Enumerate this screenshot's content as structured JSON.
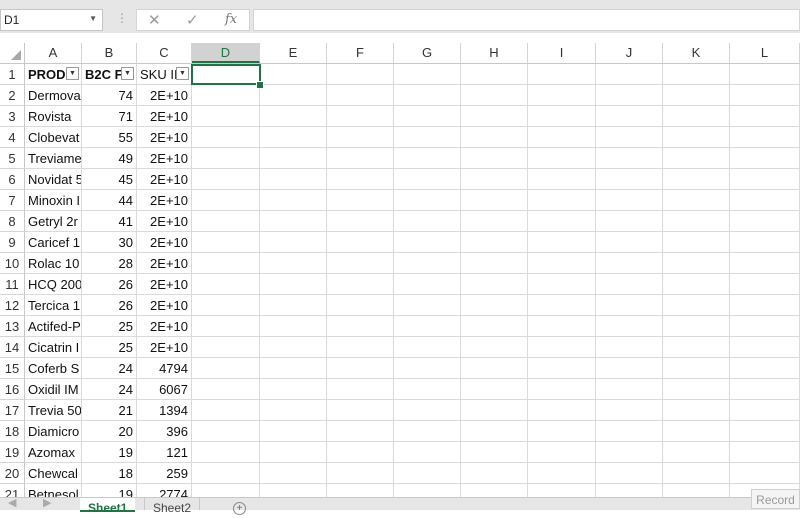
{
  "formula_bar": {
    "name_box": "D1",
    "cancel_icon": "✕",
    "enter_icon": "✓",
    "function_icon": "fx",
    "formula": ""
  },
  "columns": [
    "A",
    "B",
    "C",
    "D",
    "E",
    "F",
    "G",
    "H",
    "I",
    "J",
    "K",
    "L"
  ],
  "selected_column": "D",
  "header_row": {
    "row": "1",
    "a": "PRODU",
    "b": "B2C F",
    "c": "SKU II"
  },
  "rows": [
    {
      "row": "2",
      "a": "Dermova",
      "b": "74",
      "c": "2E+10"
    },
    {
      "row": "3",
      "a": "Rovista",
      "b": "71",
      "c": "2E+10"
    },
    {
      "row": "4",
      "a": "Clobevat",
      "b": "55",
      "c": "2E+10"
    },
    {
      "row": "5",
      "a": "Treviame",
      "b": "49",
      "c": "2E+10"
    },
    {
      "row": "6",
      "a": "Novidat 5",
      "b": "45",
      "c": "2E+10"
    },
    {
      "row": "7",
      "a": "Minoxin I",
      "b": "44",
      "c": "2E+10"
    },
    {
      "row": "8",
      "a": "Getryl 2r",
      "b": "41",
      "c": "2E+10"
    },
    {
      "row": "9",
      "a": "Caricef 1",
      "b": "30",
      "c": "2E+10"
    },
    {
      "row": "10",
      "a": "Rolac 10",
      "b": "28",
      "c": "2E+10"
    },
    {
      "row": "11",
      "a": "HCQ 200",
      "b": "26",
      "c": "2E+10"
    },
    {
      "row": "12",
      "a": "Tercica 1",
      "b": "26",
      "c": "2E+10"
    },
    {
      "row": "13",
      "a": "Actifed-P",
      "b": "25",
      "c": "2E+10"
    },
    {
      "row": "14",
      "a": "Cicatrin I",
      "b": "25",
      "c": "2E+10"
    },
    {
      "row": "15",
      "a": "Coferb S",
      "b": "24",
      "c": "4794"
    },
    {
      "row": "16",
      "a": "Oxidil IM",
      "b": "24",
      "c": "6067"
    },
    {
      "row": "17",
      "a": "Trevia 50",
      "b": "21",
      "c": "1394"
    },
    {
      "row": "18",
      "a": "Diamicro",
      "b": "20",
      "c": "396"
    },
    {
      "row": "19",
      "a": "Azomax",
      "b": "19",
      "c": "121"
    },
    {
      "row": "20",
      "a": "Chewcal",
      "b": "18",
      "c": "259"
    },
    {
      "row": "21",
      "a": "Betnesol",
      "b": "19",
      "c": "2774"
    }
  ],
  "sheets": [
    {
      "label": "Sheet1",
      "active": true
    },
    {
      "label": "Sheet2",
      "active": false
    }
  ],
  "add_sheet_icon": "+",
  "status": {
    "record_label": "Record"
  },
  "colors": {
    "accent": "#217346",
    "chrome": "#e6e6e6",
    "gridline": "#dadada"
  }
}
